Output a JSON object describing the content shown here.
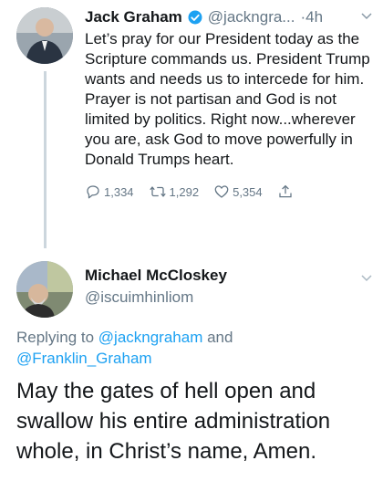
{
  "tweet1": {
    "author_name": "Jack Graham",
    "handle": "@jackngra...",
    "time": "·4h",
    "text": "Let’s pray for our President today as the Scripture commands us. President Trump wants and needs us to intercede for him. Prayer is not partisan and God is not limited by politics. Right now...wherever you are, ask God to move powerfully in Donald Trumps heart.",
    "replies": "1,334",
    "retweets": "1,292",
    "likes": "5,354"
  },
  "tweet2": {
    "author_name": "Michael McCloskey",
    "handle": "@iscuimhinliom",
    "replying_prefix": "Replying to ",
    "replying_user1": "@jackngraham",
    "replying_and": " and",
    "replying_user2": "@Franklin_Graham",
    "text": "May the gates of hell open and swallow his entire administration whole, in Christ’s name, Amen."
  },
  "colors": {
    "link": "#1da1f2",
    "secondary_text": "#657786",
    "verified_badge": "#1da1f2",
    "thread_line": "#ccd6dd"
  }
}
